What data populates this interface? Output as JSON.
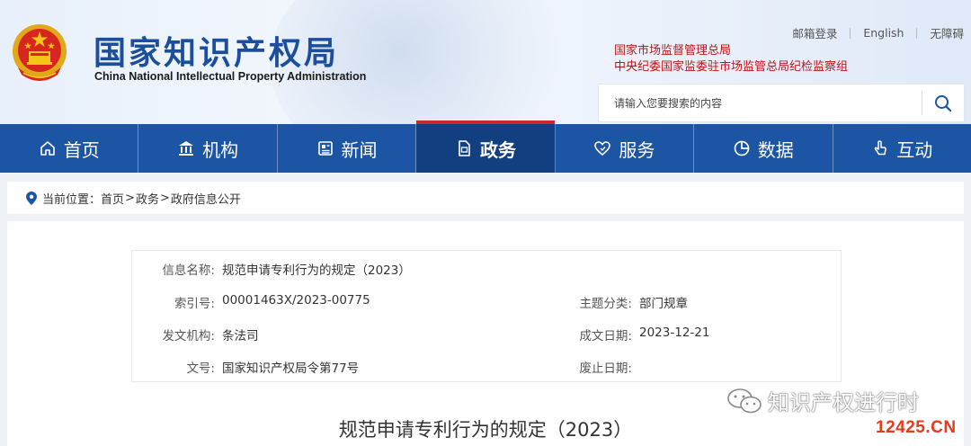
{
  "header": {
    "title_cn": "国家知识产权局",
    "title_en": "China National Intellectual Property Administration",
    "top_links": [
      "邮箱登录",
      "English",
      "无障碍"
    ],
    "org_links": [
      "国家市场监督管理总局",
      "中央纪委国家监委驻市场监管总局纪检监察组"
    ],
    "search_placeholder": "请输入您要搜索的内容"
  },
  "nav": {
    "items": [
      {
        "label": "首页",
        "icon": "home-icon"
      },
      {
        "label": "机构",
        "icon": "building-icon"
      },
      {
        "label": "新闻",
        "icon": "newspaper-icon"
      },
      {
        "label": "政务",
        "icon": "document-icon",
        "active": true
      },
      {
        "label": "服务",
        "icon": "heart-hand-icon"
      },
      {
        "label": "数据",
        "icon": "pie-chart-icon"
      },
      {
        "label": "互动",
        "icon": "hand-pointer-icon"
      }
    ],
    "active_accent": "#c62a2a",
    "bar_color": "#1c55a4"
  },
  "breadcrumb": {
    "prefix": "当前位置：",
    "items": [
      "首页",
      "政务",
      "政府信息公开"
    ],
    "separator": ">"
  },
  "info": {
    "name_label": "信息名称:",
    "name_value": "规范申请专利行为的规定（2023）",
    "index_label": "索引号:",
    "index_value": "00001463X/2023-00775",
    "topic_label": "主题分类:",
    "topic_value": "部门规章",
    "issuer_label": "发文机构:",
    "issuer_value": "条法司",
    "date_label": "成文日期:",
    "date_value": "2023-12-21",
    "docno_label": "文号:",
    "docno_value": "国家知识产权局令第77号",
    "abolish_label": "废止日期:",
    "abolish_value": ""
  },
  "doc_title": "规范申请专利行为的规定（2023）",
  "watermark": {
    "account": "知识产权进行时",
    "site": "12425.CN"
  }
}
